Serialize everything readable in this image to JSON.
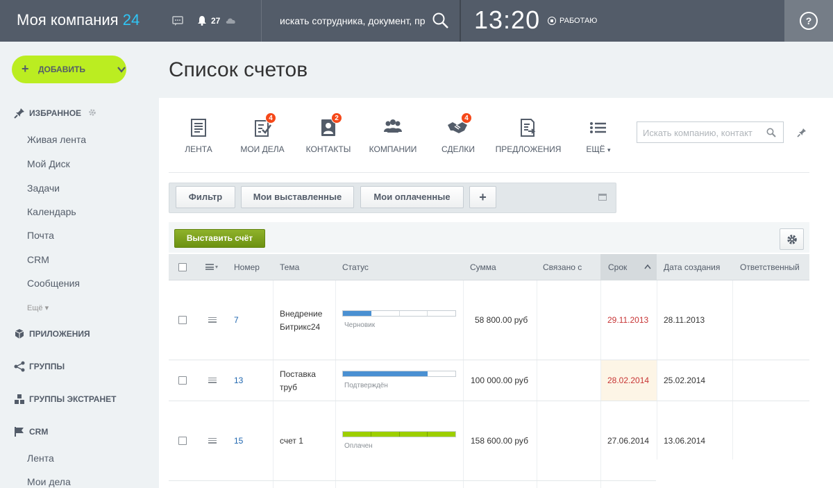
{
  "header": {
    "brand_name": "Моя компания",
    "brand_number": "24",
    "notifications_count": "27",
    "search_placeholder": "искать сотрудника, документ, прочее...",
    "time": "13:20",
    "status": "РАБОТАЮ",
    "help_label": "?"
  },
  "sidebar": {
    "add_button": "ДОБАВИТЬ",
    "favorites": "ИЗБРАННОЕ",
    "favorite_items": [
      "Живая лента",
      "Мой Диск",
      "Задачи",
      "Календарь",
      "Почта",
      "CRM",
      "Сообщения"
    ],
    "more": "Ещё",
    "apps": "ПРИЛОЖЕНИЯ",
    "groups": "ГРУППЫ",
    "extranet_groups": "ГРУППЫ ЭКСТРАНЕТ",
    "crm": "CRM",
    "crm_items": [
      "Лента",
      "Мои дела"
    ]
  },
  "page_title": "Список счетов",
  "crm_toolbar": {
    "items": [
      {
        "label": "ЛЕНТА",
        "icon": "feed-icon",
        "badge": ""
      },
      {
        "label": "МОИ ДЕЛА",
        "icon": "activities-icon",
        "badge": "4"
      },
      {
        "label": "КОНТАКТЫ",
        "icon": "contacts-icon",
        "badge": "2"
      },
      {
        "label": "КОМПАНИИ",
        "icon": "companies-icon",
        "badge": ""
      },
      {
        "label": "СДЕЛКИ",
        "icon": "deals-icon",
        "badge": "4"
      },
      {
        "label": "ПРЕДЛОЖЕНИЯ",
        "icon": "quotes-icon",
        "badge": ""
      },
      {
        "label": "ЕЩЁ",
        "icon": "more-list-icon",
        "badge": ""
      }
    ],
    "search_placeholder": "Искать компанию, контакт"
  },
  "filter": {
    "filter_button": "Фильтр",
    "presets": [
      "Мои выставленные",
      "Мои оплаченные"
    ],
    "add_label": "+"
  },
  "grid": {
    "issue_button": "Выставить счёт",
    "columns": [
      "Номер",
      "Тема",
      "Статус",
      "Сумма",
      "Связано с",
      "Срок",
      "Дата создания",
      "Ответственный"
    ],
    "rows": [
      {
        "number": "7",
        "subject_line1": "Внедрение",
        "subject_line2": "Битрикс24",
        "status": "Черновик",
        "progress_filled": 1,
        "progress_total": 4,
        "progress_color": "#4a90d2",
        "amount": "58 800.00 руб",
        "related": "",
        "due": "29.11.2013",
        "due_overdue": true,
        "created": "28.11.2013",
        "responsible": ""
      },
      {
        "number": "13",
        "subject_line1": "Поставка",
        "subject_line2": "труб",
        "status": "Подтверждён",
        "progress_filled": 3,
        "progress_total": 4,
        "progress_color": "#4a90d2",
        "amount": "100 000.00 руб",
        "related": "",
        "due": "28.02.2014",
        "due_overdue": true,
        "created": "25.02.2014",
        "responsible": ""
      },
      {
        "number": "15",
        "subject_line1": "счет 1",
        "subject_line2": "",
        "status": "Оплачен",
        "progress_filled": 4,
        "progress_total": 4,
        "progress_color": "#9dcf00",
        "amount": "158 600.00 руб",
        "related": "",
        "due": "27.06.2014",
        "due_overdue": false,
        "created": "13.06.2014",
        "responsible": ""
      }
    ]
  },
  "colors": {
    "header_bg": "#535c69",
    "accent_green": "#bbed21",
    "brand_blue": "#2fc6f6",
    "badge_red": "#f54819",
    "link_blue": "#2067b0",
    "overdue_red": "#c73434"
  }
}
